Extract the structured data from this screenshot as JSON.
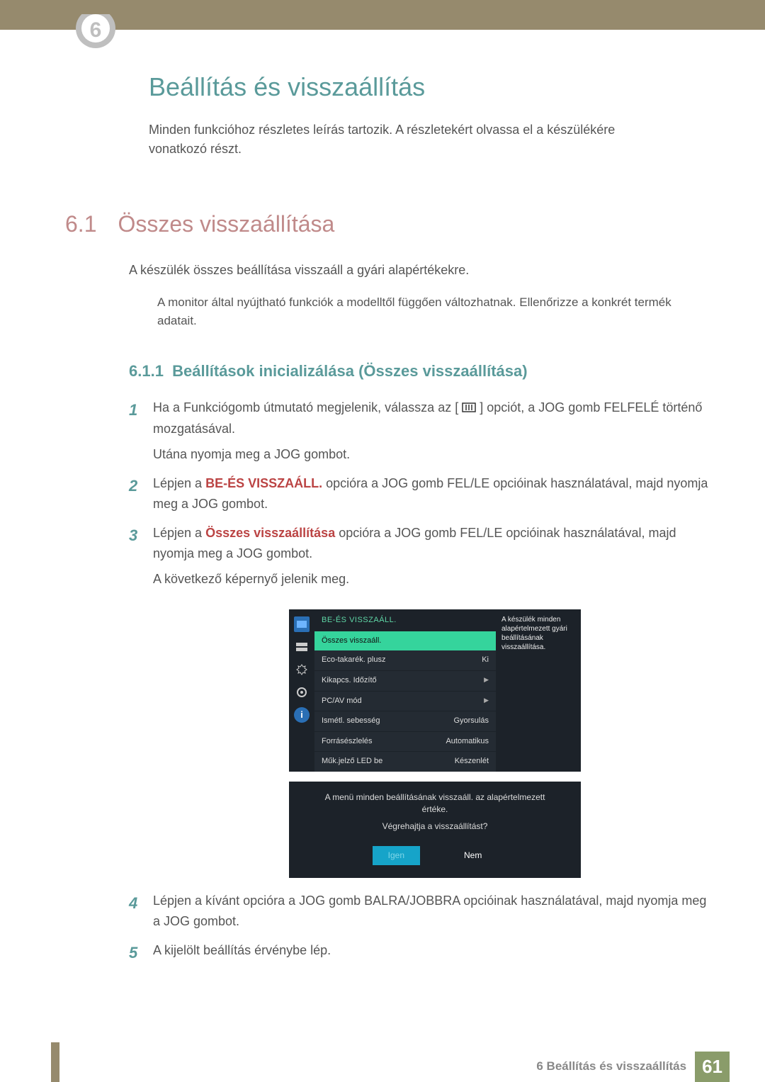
{
  "header": {
    "chapter_number": "6"
  },
  "title": "Beállítás és visszaállítás",
  "intro": "Minden funkcióhoz részletes leírás tartozik. A részletekért olvassa el a készülékére vonatkozó részt.",
  "section": {
    "number": "6.1",
    "title": "Összes visszaállítása",
    "desc": "A készülék összes beállítása visszaáll a gyári alapértékekre.",
    "note": "A monitor által nyújtható funkciók a modelltől függően változhatnak. Ellenőrizze a konkrét termék adatait."
  },
  "subsection": {
    "number": "6.1.1",
    "title": "Beállítások inicializálása (Összes visszaállítása)"
  },
  "steps": {
    "s1": {
      "num": "1",
      "a": "Ha a Funkciógomb útmutató megjelenik, válassza az [",
      "b": "] opciót, a JOG gomb FELFELÉ történő mozgatásával.",
      "c": "Utána nyomja meg a JOG gombot."
    },
    "s2": {
      "num": "2",
      "a": "Lépjen a ",
      "bold": "BE-ÉS VISSZAÁLL.",
      "b": " opcióra a JOG gomb FEL/LE opcióinak használatával, majd nyomja meg a JOG gombot."
    },
    "s3": {
      "num": "3",
      "a": "Lépjen a ",
      "bold": "Összes visszaállítása",
      "b": " opcióra a JOG gomb FEL/LE opcióinak használatával, majd nyomja meg a JOG gombot.",
      "c": "A következő képernyő jelenik meg."
    },
    "s4": {
      "num": "4",
      "text": "Lépjen a kívánt opcióra a JOG gomb BALRA/JOBBRA opcióinak használatával, majd nyomja meg a JOG gombot."
    },
    "s5": {
      "num": "5",
      "text": "A kijelölt beállítás érvénybe lép."
    }
  },
  "osd": {
    "header": "BE-ÉS VISSZAÁLL.",
    "selected": "Összes visszaáll.",
    "rows": [
      {
        "label": "Eco-takarék. plusz",
        "value": "Ki"
      },
      {
        "label": "Kikapcs. Időzítő",
        "value": "▶"
      },
      {
        "label": "PC/AV mód",
        "value": "▶"
      },
      {
        "label": "Ismétl. sebesség",
        "value": "Gyorsulás"
      },
      {
        "label": "Forrásészlelés",
        "value": "Automatikus"
      },
      {
        "label": "Műk.jelző LED be",
        "value": "Készenlét"
      }
    ],
    "tooltip": "A készülék minden alapértelmezett gyári beállításának visszaállítása.",
    "dialog": {
      "text": "A menü minden beállításának visszaáll. az alapértelmezett értéke.",
      "question": "Végrehajtja a visszaállítást?",
      "yes": "Igen",
      "no": "Nem"
    }
  },
  "footer": {
    "chapter": "6 Beállítás és visszaállítás",
    "page": "61"
  }
}
